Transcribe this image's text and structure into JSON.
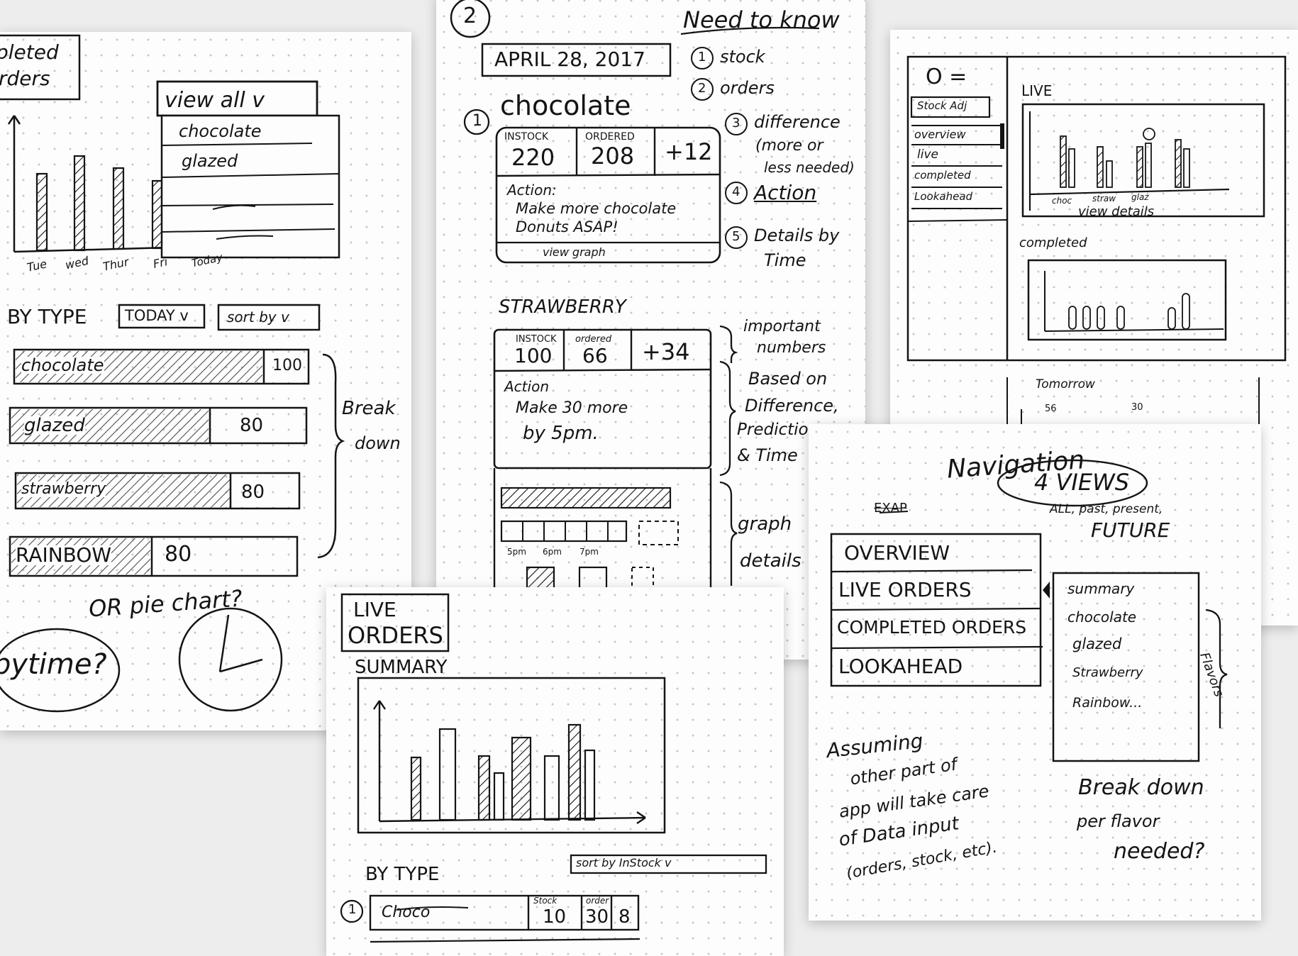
{
  "sheet_completed": {
    "title": [
      "pleted",
      "rders"
    ],
    "view_all": "view all v",
    "dropdown_items": [
      "chocolate",
      "glazed"
    ],
    "days": [
      "Tue",
      "wed",
      "Thur",
      "Fri",
      "Today"
    ],
    "by_type": "BY TYPE",
    "today_filter": "TODAY v",
    "sort_by": "sort by v",
    "breakdown": [
      {
        "name": "chocolate",
        "value": "100"
      },
      {
        "name": "glazed",
        "value": "80"
      },
      {
        "name": "strawberry",
        "value": "80"
      },
      {
        "name": "RAINBOW",
        "value": "80"
      }
    ],
    "breakdown_note": [
      "Break",
      "down"
    ],
    "pie_question": "OR pie chart?",
    "bytime": "bytime?"
  },
  "sheet_need": {
    "page_number": "2",
    "date": "APRIL 28, 2017",
    "need_title": "Need to know",
    "need_list": [
      "stock",
      "orders",
      "difference",
      "(more or",
      "less needed)",
      "Action",
      "Details by",
      "Time"
    ],
    "need_numbers": [
      "1",
      "2",
      "3",
      "4",
      "5"
    ],
    "choc_number": "1",
    "choc_title": "chocolate",
    "choc_instock_label": "INSTOCK",
    "choc_instock": "220",
    "choc_ordered_label": "ORDERED",
    "choc_ordered": "208",
    "choc_diff": "+12",
    "choc_action": [
      "Action:",
      "Make more chocolate",
      "Donuts ASAP!"
    ],
    "choc_link": "view graph",
    "straw_title": "STRAWBERRY",
    "straw_instock_label": "INSTOCK",
    "straw_instock": "100",
    "straw_ordered_label": "ordered",
    "straw_ordered": "66",
    "straw_diff": "+34",
    "straw_action": [
      "Action",
      "Make 30 more",
      "by 5pm."
    ],
    "times": [
      "5pm",
      "6pm",
      "7pm"
    ],
    "notes": [
      "important",
      "numbers",
      "Based on",
      "Difference,",
      "Prediction",
      "& Time",
      "graph",
      "details"
    ]
  },
  "sheet_screen": {
    "logo": "O =",
    "stock_btn": "Stock Adj",
    "menu": [
      "overview",
      "live",
      "completed",
      "Lookahead"
    ],
    "live_title": "LIVE",
    "tick_labels": [
      "choc",
      "straw",
      "glaz"
    ],
    "view_details": "view details",
    "completed_title": "completed",
    "tomorrow": "Tomorrow",
    "tomorrow_nums": [
      "56",
      "30"
    ]
  },
  "sheet_nav": {
    "title": "Navigation",
    "crossed": "EXAP",
    "views_badge": "4 VIEWS",
    "views_note": [
      "ALL, past, present,",
      "FUTURE"
    ],
    "menu": [
      "OVERVIEW",
      "LIVE ORDERS",
      "COMPLETED ORDERS",
      "LOOKAHEAD"
    ],
    "flavors": [
      "summary",
      "chocolate",
      "glazed",
      "Strawberry",
      "Rainbow..."
    ],
    "flavors_note": "Flavors",
    "assume": [
      "Assuming",
      "other part of",
      "app will take care",
      "of Data input",
      "(orders, stock, etc)."
    ],
    "breakdown_q": [
      "Break down",
      "per flavor",
      "needed?"
    ]
  },
  "sheet_live": {
    "title": [
      "LIVE",
      "ORDERS"
    ],
    "summary": "SUMMARY",
    "by_type": "BY TYPE",
    "sort": "sort by InStock v",
    "row_number": "1",
    "row_name": "Choco",
    "stock_label": "Stock",
    "stock_val": "10",
    "order_label": "order",
    "order_val": "30",
    "diff_val": "8"
  }
}
